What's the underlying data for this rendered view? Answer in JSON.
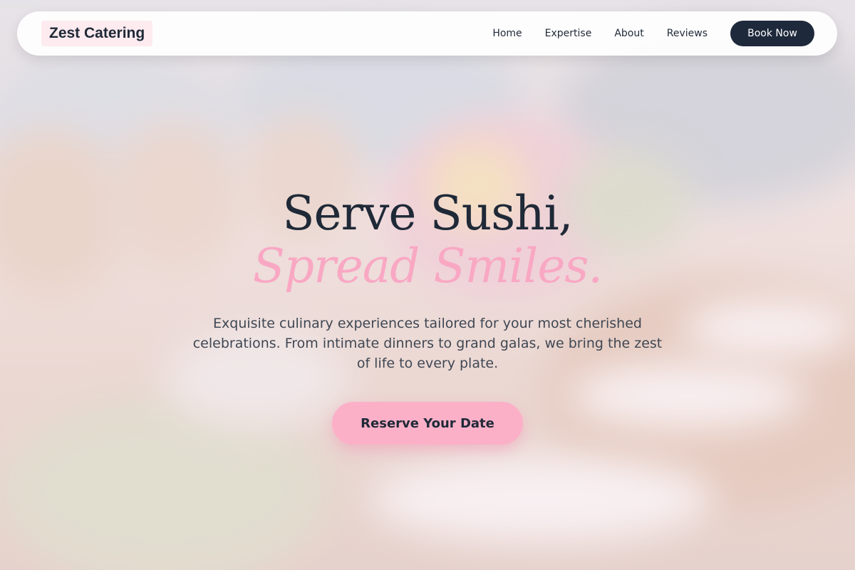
{
  "nav": {
    "logo": "Zest Catering",
    "links": [
      "Home",
      "Expertise",
      "About",
      "Reviews"
    ],
    "cta": "Book Now"
  },
  "hero": {
    "headline_line1": "Serve Sushi,",
    "headline_line2": "Spread Smiles.",
    "description": "Exquisite culinary experiences tailored for your most cherished celebrations. From intimate dinners to grand galas, we bring the zest of life to every plate.",
    "cta": "Reserve Your Date",
    "background_image": "blurred banquet table with floral centerpiece"
  },
  "colors": {
    "accent_pink": "#fbb0c8",
    "dark_navy": "#1e293b",
    "logo_bg": "#fdebef"
  }
}
